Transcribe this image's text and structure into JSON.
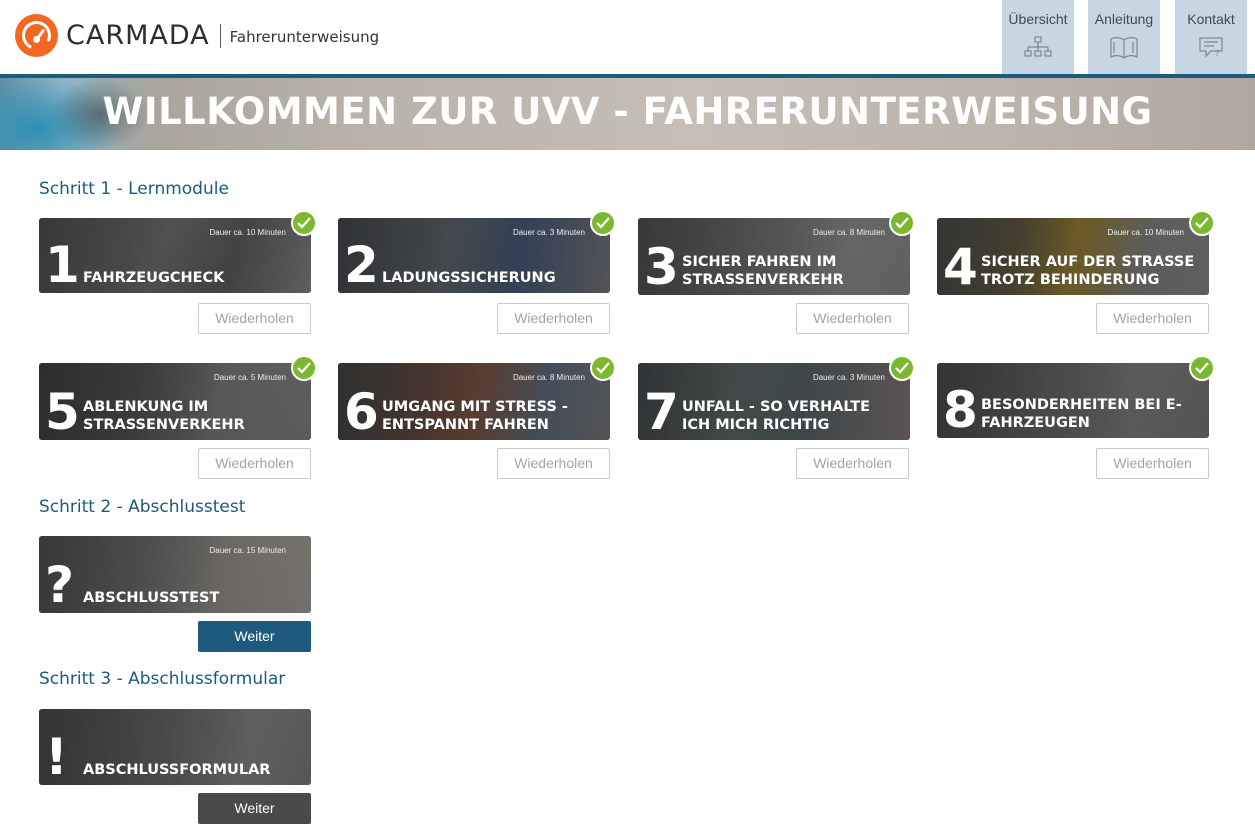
{
  "header": {
    "brand": "CARMADA",
    "subtitle": "Fahrerunterweisung",
    "brand_color": "#f26722",
    "nav": [
      {
        "label": "Übersicht",
        "icon": "sitemap-icon"
      },
      {
        "label": "Anleitung",
        "icon": "book-icon"
      },
      {
        "label": "Kontakt",
        "icon": "chat-icon"
      }
    ]
  },
  "banner": {
    "title": "WILLKOMMEN ZUR UVV - FAHRERUNTERWEISUNG"
  },
  "steps": [
    {
      "title": "Schritt 1 - Lernmodule",
      "modules": [
        {
          "number": "1",
          "title": "FAHRZEUGCHECK",
          "duration": "Dauer ca. 10 Minuten",
          "completed": true,
          "button": "Wiederholen"
        },
        {
          "number": "2",
          "title": "LADUNGSSICHERUNG",
          "duration": "Dauer ca. 3 Minuten",
          "completed": true,
          "button": "Wiederholen"
        },
        {
          "number": "3",
          "title": "SICHER FAHREN IM STRASSENVERKEHR",
          "duration": "Dauer ca. 8 Minuten",
          "completed": true,
          "button": "Wiederholen"
        },
        {
          "number": "4",
          "title": "SICHER AUF DER STRASSE TROTZ BEHINDERUNG",
          "duration": "Dauer ca. 10 Minuten",
          "completed": true,
          "button": "Wiederholen"
        },
        {
          "number": "5",
          "title": "ABLENKUNG IM STRASSENVERKEHR",
          "duration": "Dauer ca. 5 Minuten",
          "completed": true,
          "button": "Wiederholen"
        },
        {
          "number": "6",
          "title": "UMGANG MIT STRESS - ENTSPANNT FAHREN",
          "duration": "Dauer ca. 8 Minuten",
          "completed": true,
          "button": "Wiederholen"
        },
        {
          "number": "7",
          "title": "UNFALL - SO VERHALTE ICH MICH RICHTIG",
          "duration": "Dauer ca. 3 Minuten",
          "completed": true,
          "button": "Wiederholen"
        },
        {
          "number": "8",
          "title": "BESONDERHEITEN BEI E-FAHRZEUGEN",
          "duration": "",
          "completed": true,
          "button": "Wiederholen"
        }
      ]
    },
    {
      "title": "Schritt 2 - Abschlusstest",
      "modules": [
        {
          "number": "?",
          "title": "ABSCHLUSSTEST",
          "duration": "Dauer ca. 15 Minuten",
          "completed": false,
          "button": "Weiter",
          "button_color": "#1d5a7d"
        }
      ]
    },
    {
      "title": "Schritt 3 - Abschlussformular",
      "modules": [
        {
          "number": "!",
          "title": "ABSCHLUSSFORMULAR",
          "duration": "",
          "completed": false,
          "button": "Weiter",
          "button_color": "#4a4a4a"
        }
      ]
    }
  ],
  "colors": {
    "accent": "#1d5a7d",
    "check": "#7cb82f",
    "nav_bg": "#c6d6e2"
  }
}
